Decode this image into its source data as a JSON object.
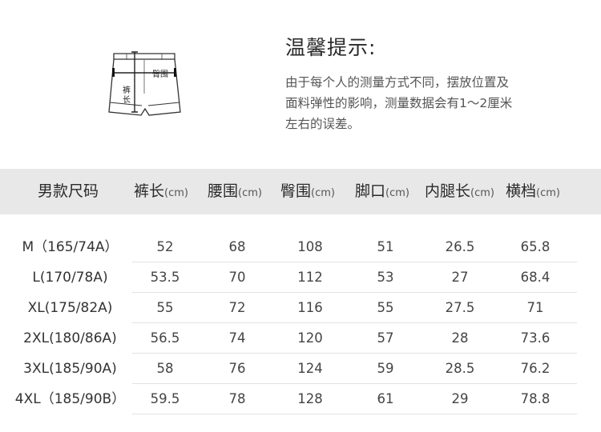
{
  "diagram": {
    "hip_label": "臀围",
    "length_label_1": "裤",
    "length_label_2": "长"
  },
  "tip": {
    "title": "温馨提示:",
    "lines": [
      "由于每个人的测量方式不同，摆放位置及",
      "面料弹性的影响，测量数据会有1～2厘米",
      "左右的误差。"
    ]
  },
  "table": {
    "size_header": "男款尺码",
    "columns": [
      {
        "name": "裤长",
        "unit": "(cm)"
      },
      {
        "name": "腰围",
        "unit": "(cm)"
      },
      {
        "name": "臀围",
        "unit": "(cm)"
      },
      {
        "name": "脚口",
        "unit": "(cm)"
      },
      {
        "name": "内腿长",
        "unit": "(cm)"
      },
      {
        "name": "横档",
        "unit": "(cm)"
      }
    ],
    "rows": [
      {
        "size": "M（165/74A）",
        "values": [
          "52",
          "68",
          "108",
          "51",
          "26.5",
          "65.8"
        ]
      },
      {
        "size": "L(170/78A)",
        "values": [
          "53.5",
          "70",
          "112",
          "53",
          "27",
          "68.4"
        ]
      },
      {
        "size": "XL(175/82A)",
        "values": [
          "55",
          "72",
          "116",
          "55",
          "27.5",
          "71"
        ]
      },
      {
        "size": "2XL(180/86A)",
        "values": [
          "56.5",
          "74",
          "120",
          "57",
          "28",
          "73.6"
        ]
      },
      {
        "size": "3XL(185/90A)",
        "values": [
          "58",
          "76",
          "124",
          "59",
          "28.5",
          "76.2"
        ]
      },
      {
        "size": "4XL（185/90B）",
        "values": [
          "59.5",
          "78",
          "128",
          "61",
          "29",
          "78.8"
        ]
      }
    ]
  },
  "colors": {
    "header_background": "#e8e8e8",
    "text": "#333333",
    "divider": "#e3e3e3"
  }
}
